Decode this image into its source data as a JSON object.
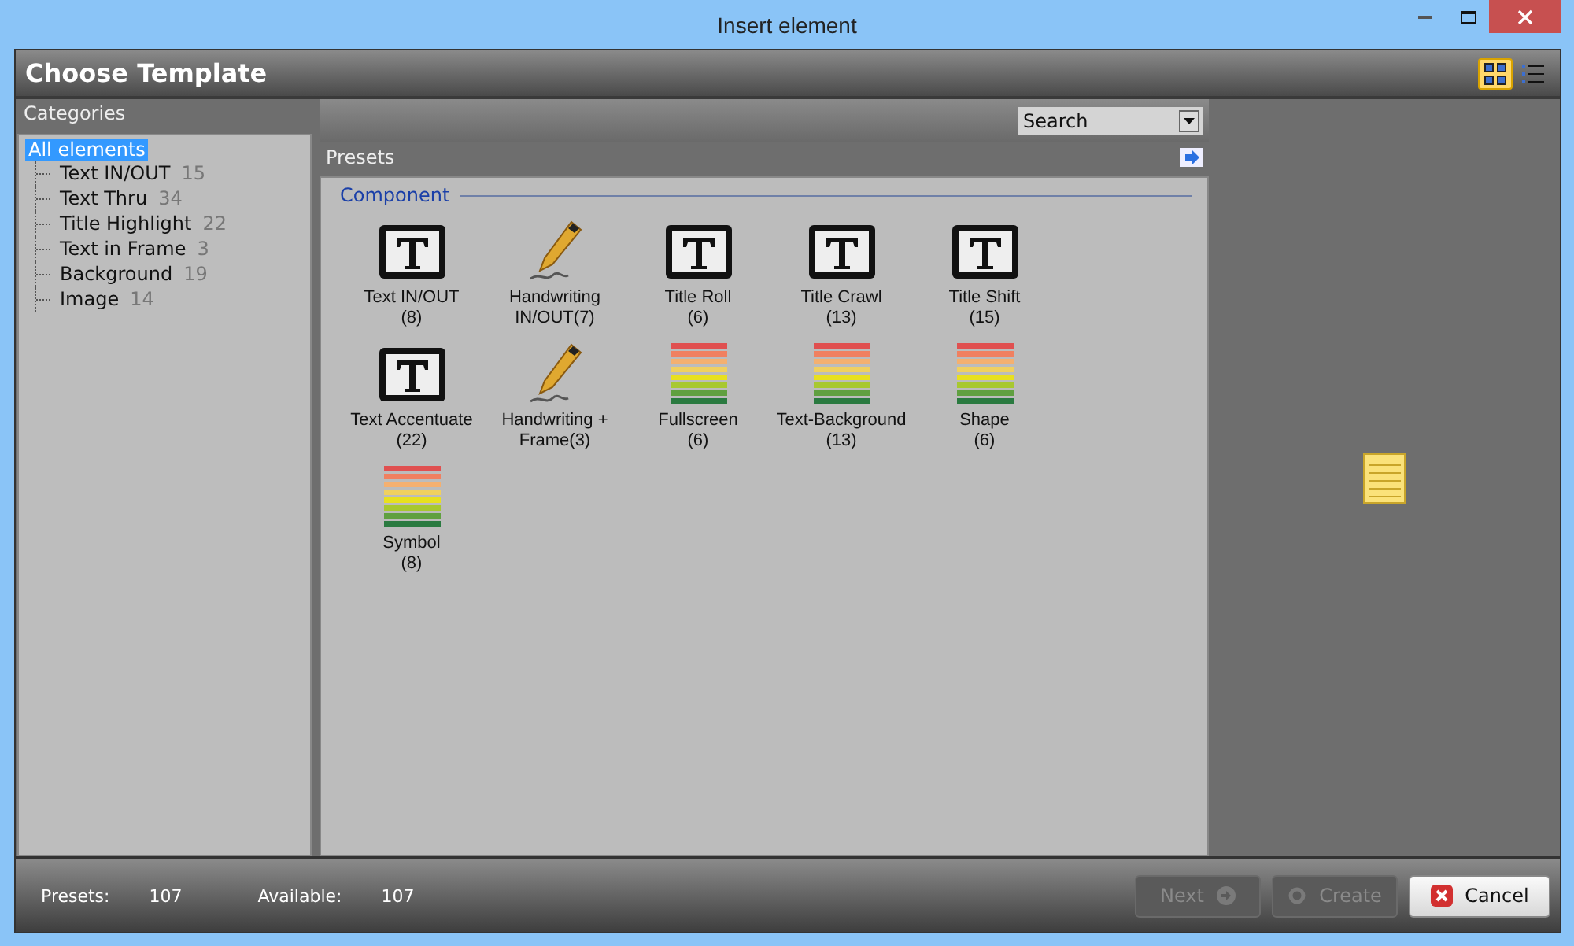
{
  "window": {
    "title": "Insert element"
  },
  "header": {
    "title": "Choose Template",
    "views": [
      {
        "kind": "grid",
        "selected": true
      },
      {
        "kind": "list",
        "selected": false
      }
    ]
  },
  "sidebar": {
    "title": "Categories",
    "root": {
      "label": "All elements",
      "selected": true,
      "children": [
        {
          "label": "Text IN/OUT",
          "count": "15",
          "selected": false
        },
        {
          "label": "Text Thru",
          "count": "34",
          "selected": false
        },
        {
          "label": "Title Highlight",
          "count": "22",
          "selected": false
        },
        {
          "label": "Text in Frame",
          "count": "3",
          "selected": false
        },
        {
          "label": "Background",
          "count": "19",
          "selected": false
        },
        {
          "label": "Image",
          "count": "14",
          "selected": false
        }
      ]
    }
  },
  "search": {
    "value": "Search"
  },
  "presets": {
    "title": "Presets",
    "group": "Component",
    "items": [
      {
        "kind": "text",
        "name": "Text IN/OUT",
        "count": "(8)"
      },
      {
        "kind": "pen",
        "name": "Handwriting IN/OUT(7)"
      },
      {
        "kind": "text",
        "name": "Title Roll",
        "count": "(6)"
      },
      {
        "kind": "text",
        "name": "Title Crawl",
        "count": "(13)"
      },
      {
        "kind": "text",
        "name": "Title Shift",
        "count": "(15)"
      },
      {
        "kind": "text",
        "name": "Text Accentuate",
        "count": "(22)"
      },
      {
        "kind": "pen",
        "name": "Handwriting + Frame(3)"
      },
      {
        "kind": "stripes",
        "name": "Fullscreen",
        "count": "(6)"
      },
      {
        "kind": "stripes",
        "name": "Text-Background",
        "count": "(13)"
      },
      {
        "kind": "stripes",
        "name": "Shape",
        "count": "(6)"
      },
      {
        "kind": "stripes",
        "name": "Symbol",
        "count": "(8)"
      }
    ]
  },
  "status": {
    "presets_label": "Presets:",
    "presets_value": "107",
    "available_label": "Available:",
    "available_value": "107"
  },
  "buttons": [
    {
      "kind": "next",
      "label": "Next",
      "disabled": true
    },
    {
      "kind": "create",
      "label": "Create",
      "disabled": true
    },
    {
      "kind": "cancel",
      "label": "Cancel",
      "disabled": false
    }
  ]
}
